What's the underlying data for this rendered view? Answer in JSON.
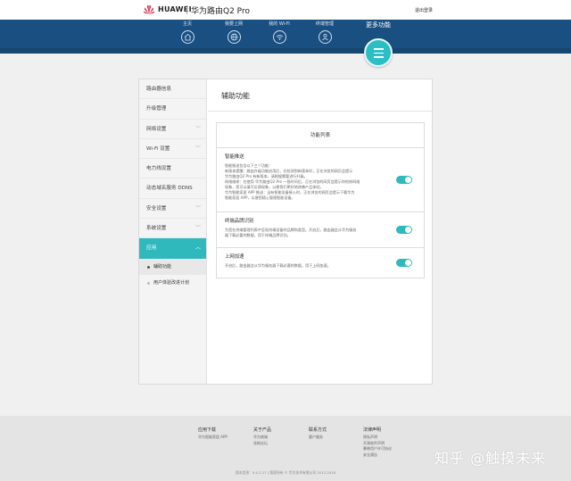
{
  "header": {
    "brand": "HUAWEI",
    "product": "华为路由Q2 Pro",
    "logout": "退出登录"
  },
  "nav": {
    "items": [
      {
        "label": "主页",
        "icon": "home-icon"
      },
      {
        "label": "我要上网",
        "icon": "globe-icon"
      },
      {
        "label": "我的 Wi-Fi",
        "icon": "wifi-icon"
      },
      {
        "label": "终端管理",
        "icon": "user-icon"
      }
    ],
    "more_label": "更多功能",
    "more_icon": "menu-icon"
  },
  "sidebar": {
    "items": [
      {
        "label": "路由器信息",
        "expandable": false
      },
      {
        "label": "升级管理",
        "expandable": false
      },
      {
        "label": "网络设置",
        "expandable": true
      },
      {
        "label": "Wi-Fi 设置",
        "expandable": true
      },
      {
        "label": "电力线设置",
        "expandable": false
      },
      {
        "label": "动态域名服务 DDNS",
        "expandable": false
      },
      {
        "label": "安全设置",
        "expandable": true
      },
      {
        "label": "系统设置",
        "expandable": true
      }
    ],
    "active_group": "应用",
    "sub_items": [
      {
        "label": "辅助功能",
        "current": true
      },
      {
        "label": "用户体验改进计划",
        "current": false
      }
    ]
  },
  "content": {
    "title": "辅助功能",
    "list_header": "功能列表",
    "features": [
      {
        "name": "智能推送",
        "lines": [
          "智能推送包含以下三个功能：",
          "新版本提醒：路由升级功能启用后，在检测到新版本时，正在浏览的网页会提示",
          "华为路由Q2 Pro 有新版本，请根据需要进行升级。",
          "网络维修：在使用 华为路由Q2 Pro 一段时间后，正在浏览的网页会提示你检修网络",
          "现象，您可以填写反馈现象，以便我们更好地改善产品体验。",
          "华为智能家居 APP 推送：当有智能设备接入时，正在浏览的网页会提示下载华为",
          "智能家居 APP，以便您随心管理智能设备。"
        ],
        "enabled": true
      },
      {
        "name": "终端品牌识别",
        "lines": [
          "为您在终端管理列表中呈现终端设备的品牌和类型。开启后，路由器会从华为服务",
          "器下载必要的数据，用于终端品牌识别。"
        ],
        "enabled": true
      },
      {
        "name": "上网加速",
        "lines": [
          "开启后，路由器会从华为服务器下载必要的数据，用于上网加速。"
        ],
        "enabled": true
      }
    ]
  },
  "footer": {
    "columns": [
      {
        "title": "应用下载",
        "links": [
          "华为智能家居 APP"
        ]
      },
      {
        "title": "关于产品",
        "links": [
          "华为商城",
          "花粉论坛"
        ]
      },
      {
        "title": "联系方式",
        "links": [
          "客户服务"
        ]
      },
      {
        "title": "法律声明",
        "links": [
          "隐私声明",
          "开源软件声明",
          "暴晓用户许可协议",
          "安全通告"
        ]
      }
    ],
    "copyright": "版本信息：9.0.2.17 | 版权所有 © 华为技术有限公司 2012-2018"
  },
  "watermark": "知乎 @触摸未来",
  "colors": {
    "nav_blue": "#1a4f82",
    "accent_teal": "#2fb9bd"
  }
}
